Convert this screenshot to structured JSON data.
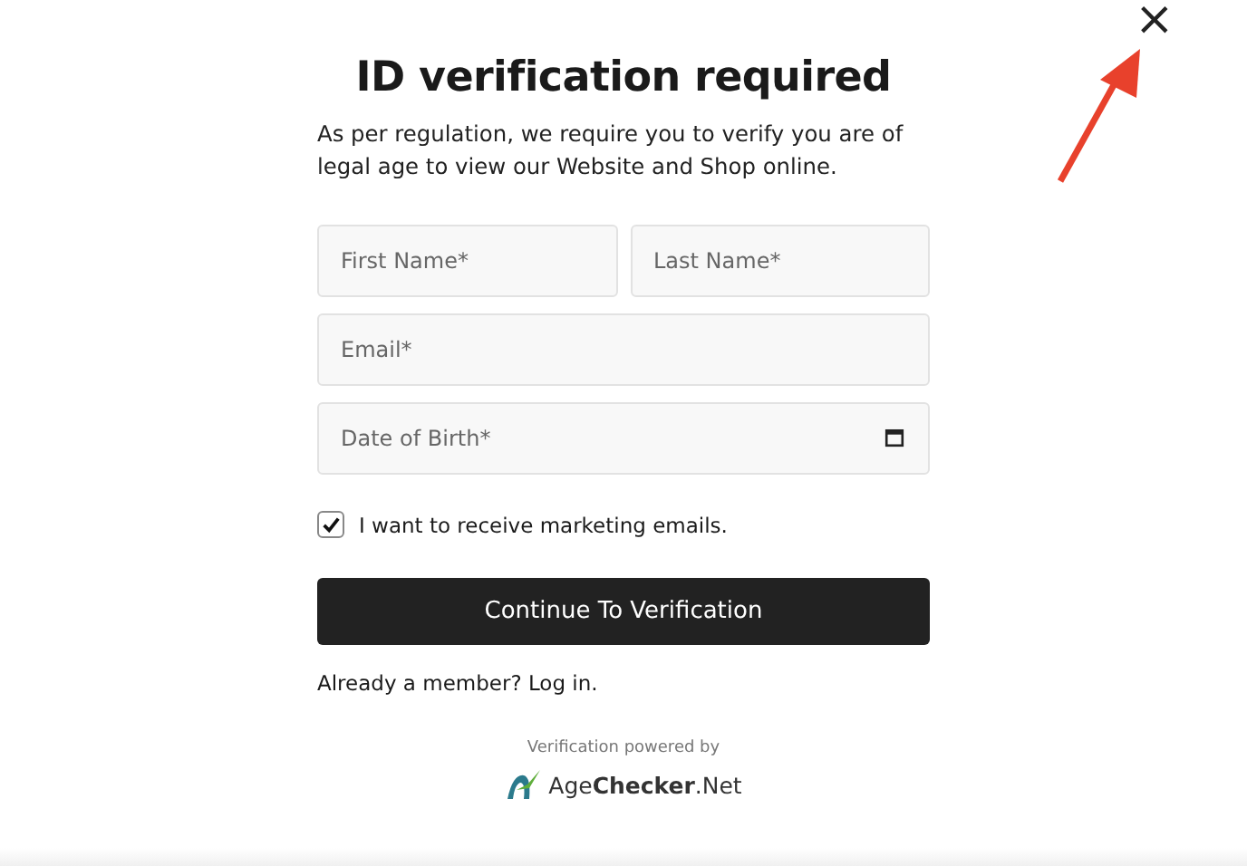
{
  "close_button": {
    "label": "×"
  },
  "title": "ID verification required",
  "intro": "As per regulation, we require you to verify you are of legal age to view our Website and Shop online.",
  "field_rows": [
    [
      {
        "kind": "text",
        "placeholder": "First Name*"
      },
      {
        "kind": "text",
        "placeholder": "Last Name*"
      }
    ],
    [
      {
        "kind": "text",
        "placeholder": "Email*"
      }
    ],
    [
      {
        "kind": "date",
        "placeholder": "Date of Birth*"
      }
    ]
  ],
  "marketing_checkbox": {
    "label": "I want to receive marketing emails.",
    "checked": true
  },
  "submit_button": "Continue To Verification",
  "login": {
    "prompt": "Already a member?",
    "link": "Log in."
  },
  "powered_by": "Verification powered by",
  "logo_text": "Age**Checker**.Net"
}
